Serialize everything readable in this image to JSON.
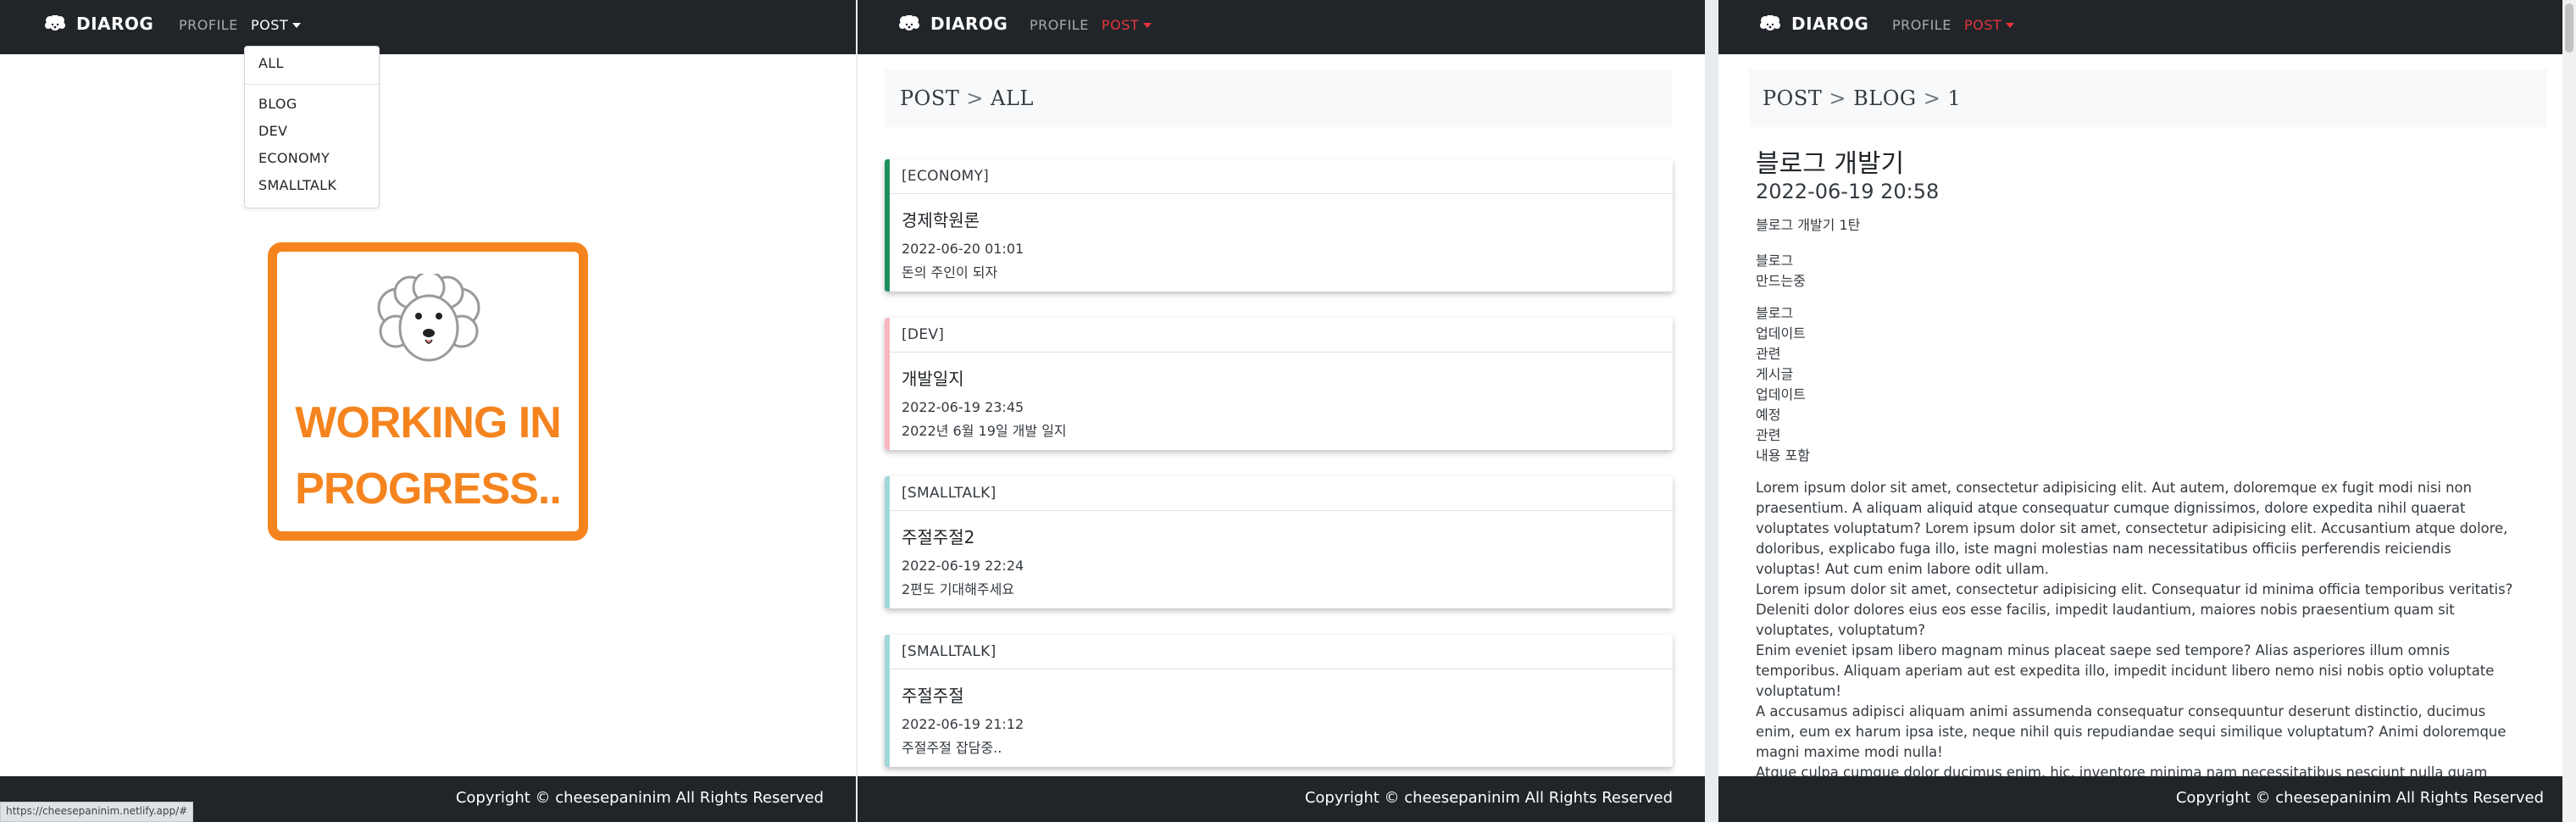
{
  "brand": {
    "name": "DIAROG",
    "logo_icon": "poodle-icon"
  },
  "nav": {
    "profile": "PROFILE",
    "post": "POST"
  },
  "colors": {
    "active_nav": "#e8343d",
    "navbar_bg": "#212529",
    "accent_orange": "#f5841f",
    "economy": "#1f8f5f",
    "dev": "#f5b8be",
    "smalltalk": "#9fd8d8"
  },
  "dropdown": {
    "all": "ALL",
    "blog": "BLOG",
    "dev": "DEV",
    "economy": "ECONOMY",
    "smalltalk": "SMALLTALK"
  },
  "wip": {
    "line1": "WORKING IN",
    "line2": "PROGRESS.."
  },
  "status_url": "https://cheesepaninim.netlify.app/#",
  "footer": {
    "text": "Copyright © cheesepaninim All Rights Reserved"
  },
  "list_page": {
    "crumb": {
      "a": "POST",
      "sep": ">",
      "b": "ALL"
    },
    "cards": [
      {
        "category": "[ECONOMY]",
        "title": "경제학원론",
        "date": "2022-06-20 01:01",
        "desc": "돈의 주인이 되자"
      },
      {
        "category": "[DEV]",
        "title": "개발일지",
        "date": "2022-06-19 23:45",
        "desc": "2022년 6월 19일 개발 일지"
      },
      {
        "category": "[SMALLTALK]",
        "title": "주절주절2",
        "date": "2022-06-19 22:24",
        "desc": "2편도 기대해주세요"
      },
      {
        "category": "[SMALLTALK]",
        "title": "주절주절",
        "date": "2022-06-19 21:12",
        "desc": "주절주절 잡담중.."
      }
    ]
  },
  "detail_page": {
    "crumb": {
      "a": "POST",
      "sep1": ">",
      "b": "BLOG",
      "sep2": ">",
      "c": "1"
    },
    "title": "블로그 개발기",
    "date": "2022-06-19 20:58",
    "subtitle": "블로그 개발기 1탄",
    "lines": [
      "블로그",
      "만드는중",
      "블로그",
      "업데이트",
      "관련",
      "게시글",
      "업데이트",
      "예정",
      "관련",
      "내용 포함"
    ],
    "lorem": [
      "Lorem ipsum dolor sit amet, consectetur adipisicing elit. Aut autem, doloremque ex fugit modi nisi non praesentium. A aliquam aliquid atque consequatur cumque dignissimos, dolore expedita nihil quaerat voluptates voluptatum? Lorem ipsum dolor sit amet, consectetur adipisicing elit. Accusantium atque dolore, doloribus, explicabo fuga illo, iste magni molestias nam necessitatibus officiis perferendis reiciendis voluptas! Aut cum enim labore odit ullam.",
      "Lorem ipsum dolor sit amet, consectetur adipisicing elit. Consequatur id minima officia temporibus veritatis? Deleniti dolor dolores eius eos esse facilis, impedit laudantium, maiores nobis praesentium quam sit voluptates, voluptatum?",
      "Enim eveniet ipsam libero magnam minus placeat saepe sed tempore? Alias asperiores illum omnis temporibus. Aliquam aperiam aut est expedita illo, impedit incidunt libero nemo nisi nobis optio voluptate voluptatum!",
      "A accusamus adipisci aliquam animi assumenda consequatur consequuntur deserunt distinctio, ducimus enim, eum ex harum ipsa iste, neque nihil quis repudiandae sequi similique voluptatum? Animi doloremque magni maxime modi nulla!",
      "Atque culpa cumque dolor ducimus enim, hic, inventore minima nam necessitatibus nesciunt nulla quam quos voluptate? Accusantium animi, asperiatur atque dolorum et omnis porro quod repudiandae sequi! Et laboriosam"
    ]
  }
}
